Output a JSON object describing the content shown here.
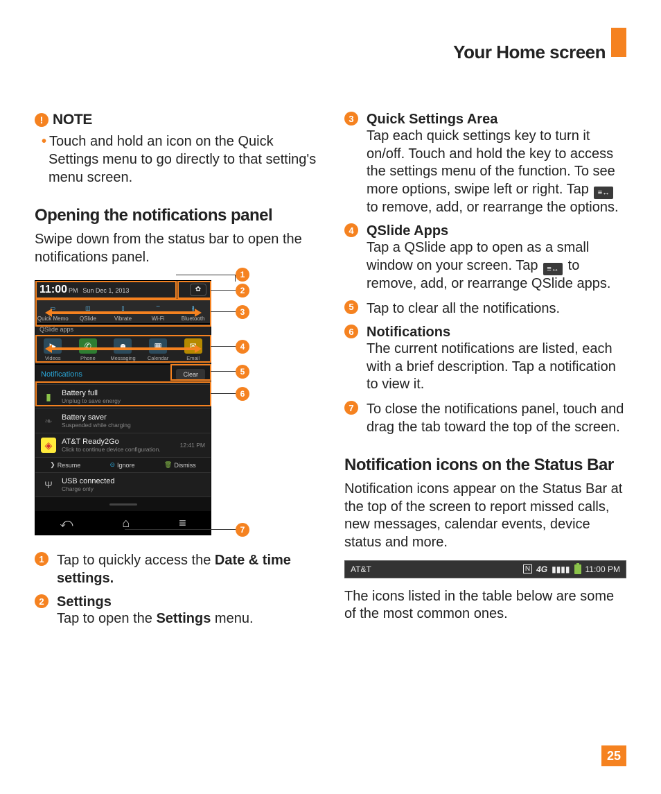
{
  "header": {
    "title": "Your Home screen"
  },
  "note": {
    "label": "NOTE",
    "text": "Touch and hold an icon on the Quick Settings menu to go directly to that setting's menu screen."
  },
  "section1": {
    "heading": "Opening the notifications panel",
    "text": "Swipe down from the status bar to open the notifications panel."
  },
  "callouts": {
    "c1": {
      "pre": "Tap to quickly access the ",
      "bold": "Date & time settings."
    },
    "c2": {
      "title": "Settings",
      "pre": "Tap to open the ",
      "bold": "Settings",
      "post": " menu."
    },
    "c3": {
      "title": "Quick Settings Area",
      "text_a": "Tap each quick settings key to turn it on/off. Touch and hold the key to access the settings menu of the function. To see more options, swipe left or right. Tap ",
      "text_b": " to remove, add, or rearrange the options."
    },
    "c4": {
      "title": "QSlide Apps",
      "text_a": "Tap a QSlide app to open as a small window on your screen. Tap ",
      "text_b": " to remove, add, or rearrange QSlide apps."
    },
    "c5": {
      "text": "Tap to clear all the notifications."
    },
    "c6": {
      "title": "Notifications",
      "text": "The current notifications are listed, each with a brief description. Tap a notification to view it."
    },
    "c7": {
      "text": "To close the notifications panel, touch and drag the tab toward the top of the screen."
    }
  },
  "section2": {
    "heading": "Notification icons on the Status Bar",
    "text1": "Notification icons appear on the Status Bar at the top of the screen to report missed calls, new messages, calendar events, device status and more.",
    "text2": "The icons listed in the table below are some of the most common ones."
  },
  "phone": {
    "time": "11:00",
    "ampm": "PM",
    "date": "Sun Dec 1, 2013",
    "qs": [
      "Quick Memo",
      "QSlide",
      "Vibrate",
      "Wi-Fi",
      "Bluetooth"
    ],
    "qslide_label": "QSlide apps",
    "qslide": [
      "Videos",
      "Phone",
      "Messaging",
      "Calendar",
      "Email"
    ],
    "notif_label": "Notifications",
    "clear": "Clear",
    "n1": {
      "t": "Battery full",
      "s": "Unplug to save energy"
    },
    "n2": {
      "t": "Battery saver",
      "s": "Suspended while charging"
    },
    "n3": {
      "t": "AT&T Ready2Go",
      "s": "Click to continue device configuration.",
      "time": "12:41 PM"
    },
    "actions": {
      "resume": "Resume",
      "ignore": "Ignore",
      "dismiss": "Dismiss"
    },
    "n4": {
      "t": "USB connected",
      "s": "Charge only"
    }
  },
  "statusbar": {
    "carrier": "AT&T",
    "time": "11:00 PM"
  },
  "page": "25"
}
